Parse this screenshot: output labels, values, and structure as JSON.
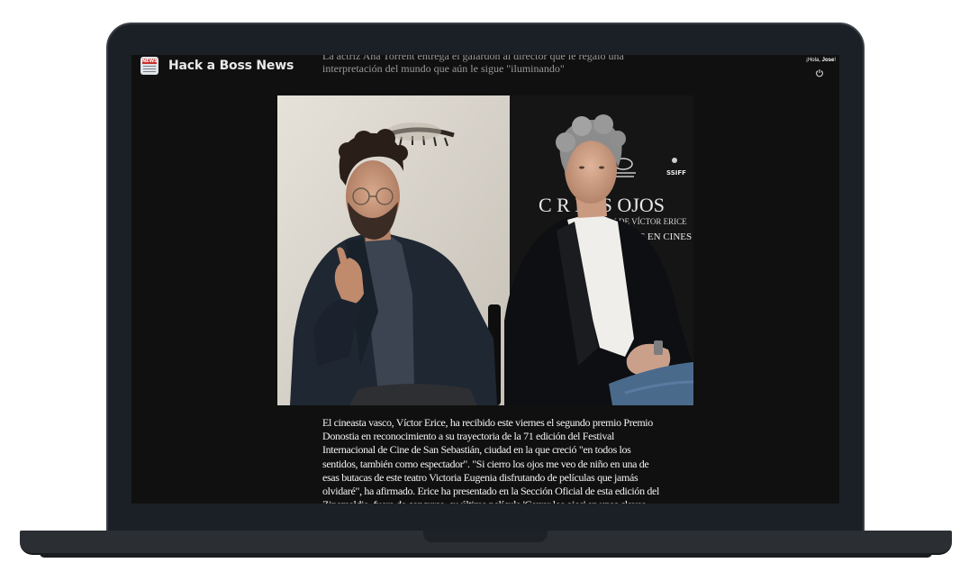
{
  "app": {
    "brand": "Hack a Boss News",
    "greeting_prefix": "¡Hola, ",
    "user_name": "Jose",
    "greeting_suffix": "!"
  },
  "article": {
    "subtitle": "La actriz Ana Torrent entrega el galardón al director que le regaló una interpretación del mundo que aún le sigue \"iluminando\"",
    "photo": {
      "poster_text_1": "C  R LOS OJOS",
      "poster_text_2": "UN FILM DE VÍCTOR ERICE",
      "poster_text_3": "PRE EN CINES",
      "festival_badge": "SSIFF"
    },
    "body": "El cineasta vasco, Víctor Erice, ha recibido este viernes el segundo premio Premio Donostia en reconocimiento a su trayectoria de la 71 edición del Festival Internacional de Cine de San Sebastián, ciudad en la que creció \"en todos los sentidos, también como espectador\". \"Si cierro los ojos me veo de niño en una de esas butacas de este teatro Victoria Eugenia disfrutando de películas que jamás olvidaré\", ha afirmado. Erice ha presentado en la Sección Oficial de esta edición del Zinemaldia, fuera de concurso, su última película 'Cerrar los ojos' en unas claves que"
  },
  "colors": {
    "screen_bg": "#101010",
    "bezel": "#1b2027",
    "text": "#f2f2f2",
    "muted": "#9a9a9a"
  }
}
